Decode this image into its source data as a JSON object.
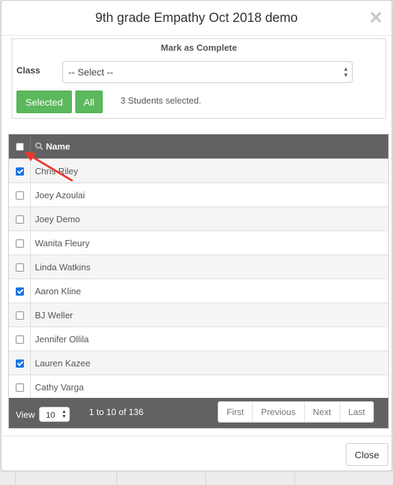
{
  "modal": {
    "title": "9th grade Empathy Oct 2018 demo",
    "close_icon": "×"
  },
  "complete_panel": {
    "heading": "Mark as Complete",
    "class_label": "Class",
    "class_select_value": "-- Select --",
    "selected_button": "Selected",
    "all_button": "All",
    "selected_count": "3 Students selected."
  },
  "table": {
    "header": {
      "name": "Name",
      "search_icon": "search-icon",
      "select_all_checked": false
    },
    "rows": [
      {
        "name": "Chris Riley",
        "checked": true
      },
      {
        "name": "Joey Azoulai",
        "checked": false
      },
      {
        "name": "Joey Demo",
        "checked": false
      },
      {
        "name": "Wanita Fleury",
        "checked": false
      },
      {
        "name": "Linda Watkins",
        "checked": false
      },
      {
        "name": "Aaron Kline",
        "checked": true
      },
      {
        "name": "BJ Weller",
        "checked": false
      },
      {
        "name": "Jennifer Ollila",
        "checked": false
      },
      {
        "name": "Lauren Kazee",
        "checked": true
      },
      {
        "name": "Cathy Varga",
        "checked": false
      }
    ],
    "footer": {
      "view_label": "View",
      "view_value": "10",
      "range": "1 to 10 of 136",
      "first": "First",
      "previous": "Previous",
      "next": "Next",
      "last": "Last"
    }
  },
  "footer": {
    "close_button": "Close"
  },
  "colors": {
    "accent_green": "#5cb85c",
    "checkbox_blue": "#1a73e8",
    "table_header": "#626262",
    "annotation_arrow": "#e8392d"
  }
}
